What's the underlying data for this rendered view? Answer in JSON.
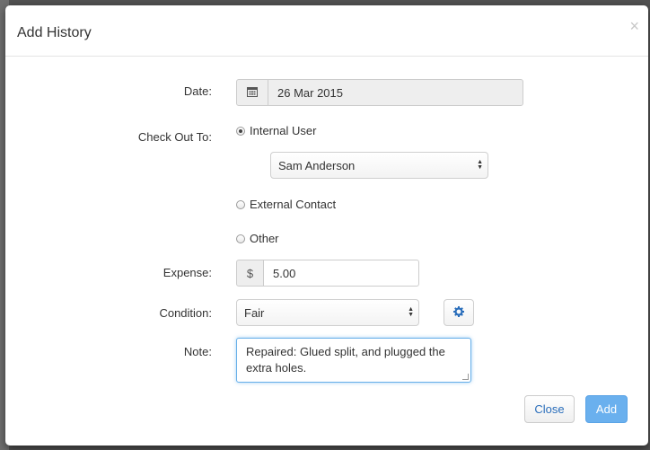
{
  "modal": {
    "title": "Add History",
    "close_glyph": "×"
  },
  "form": {
    "date": {
      "label": "Date:",
      "value": "26 Mar 2015",
      "icon": "calendar-icon"
    },
    "check_out_to": {
      "label": "Check Out To:",
      "options": [
        {
          "label": "Internal User",
          "checked": true
        },
        {
          "label": "External Contact",
          "checked": false
        },
        {
          "label": "Other",
          "checked": false
        }
      ],
      "internal_user_selected": "Sam Anderson"
    },
    "expense": {
      "label": "Expense:",
      "currency_symbol": "$",
      "value": "5.00"
    },
    "condition": {
      "label": "Condition:",
      "selected": "Fair",
      "settings_icon": "gear-icon"
    },
    "note": {
      "label": "Note:",
      "value": "Repaired: Glued split, and plugged the extra holes."
    }
  },
  "footer": {
    "close_label": "Close",
    "add_label": "Add"
  },
  "colors": {
    "accent": "#2a6ebb",
    "primary_button": "#6ab0ee",
    "focus_border": "#66afe9"
  }
}
